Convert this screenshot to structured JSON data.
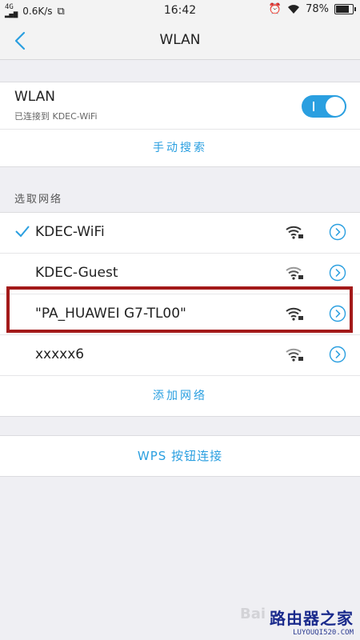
{
  "status": {
    "network": "4G",
    "speed": "0.6K/s",
    "time": "16:42",
    "battery": "78%",
    "battery_level": 0.78
  },
  "nav": {
    "title": "WLAN"
  },
  "wlan": {
    "title": "WLAN",
    "subtitle": "已连接到 KDEC-WiFi",
    "enabled": true,
    "manual_search": "手动搜索"
  },
  "networks": {
    "section_label": "选取网络",
    "items": [
      {
        "name": "KDEC-WiFi",
        "connected": true,
        "locked": true
      },
      {
        "name": "KDEC-Guest",
        "connected": false,
        "locked": true
      },
      {
        "name": "\"PA_HUAWEI G7-TL00\"",
        "connected": false,
        "locked": true
      },
      {
        "name": "xxxxx6",
        "connected": false,
        "locked": true
      }
    ],
    "add_network": "添加网络"
  },
  "wps": {
    "label": "WPS 按钮连接"
  },
  "watermark": {
    "brand": "路由器之家",
    "url": "LUYOUQI520.COM",
    "faint": "Bai"
  },
  "colors": {
    "accent": "#2a9fe0",
    "highlight": "#a31a1a"
  }
}
